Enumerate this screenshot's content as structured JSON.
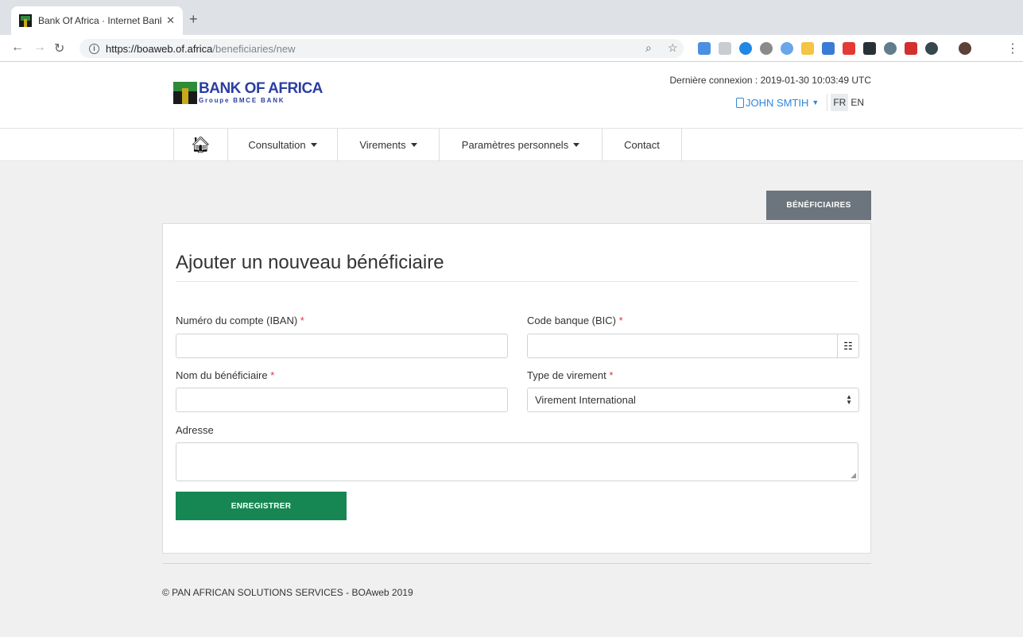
{
  "browser": {
    "tab_title": "Bank Of Africa · Internet Bankin",
    "tab_close": "✕",
    "new_tab": "+",
    "url_host": "https://boaweb.of.africa",
    "url_path": "/beneficiaries/new"
  },
  "header": {
    "logo_main": "BANK OF AFRICA",
    "logo_sub": "Groupe BMCE BANK",
    "last_login": "Dernière connexion : 2019-01-30 10:03:49 UTC",
    "user_name": "JOHN SMTIH",
    "lang_fr": "FR",
    "lang_en": "EN"
  },
  "nav": {
    "home_icon": "home-icon",
    "items": [
      {
        "label": "Consultation",
        "dropdown": true
      },
      {
        "label": "Virements",
        "dropdown": true
      },
      {
        "label": "Paramètres personnels",
        "dropdown": true
      },
      {
        "label": "Contact",
        "dropdown": false
      }
    ]
  },
  "page": {
    "beneficiaries_button": "BÉNÉFICIAIRES",
    "title": "Ajouter un nouveau bénéficiaire",
    "required_mark": "*"
  },
  "form": {
    "iban_label": "Numéro du compte (IBAN)",
    "iban_value": "",
    "bic_label": "Code banque (BIC)",
    "bic_value": "",
    "name_label": "Nom du bénéficiaire",
    "name_value": "",
    "transfer_type_label": "Type de virement",
    "transfer_type_value": "Virement International",
    "address_label": "Adresse",
    "address_value": "",
    "save_label": "ENREGISTRER"
  },
  "footer": {
    "text": "© PAN AFRICAN SOLUTIONS SERVICES - BOAweb 2019"
  },
  "colors": {
    "brand_blue": "#2b3ea3",
    "save_green": "#168753",
    "secondary_gray": "#6c757d",
    "required_red": "#dc3545"
  }
}
